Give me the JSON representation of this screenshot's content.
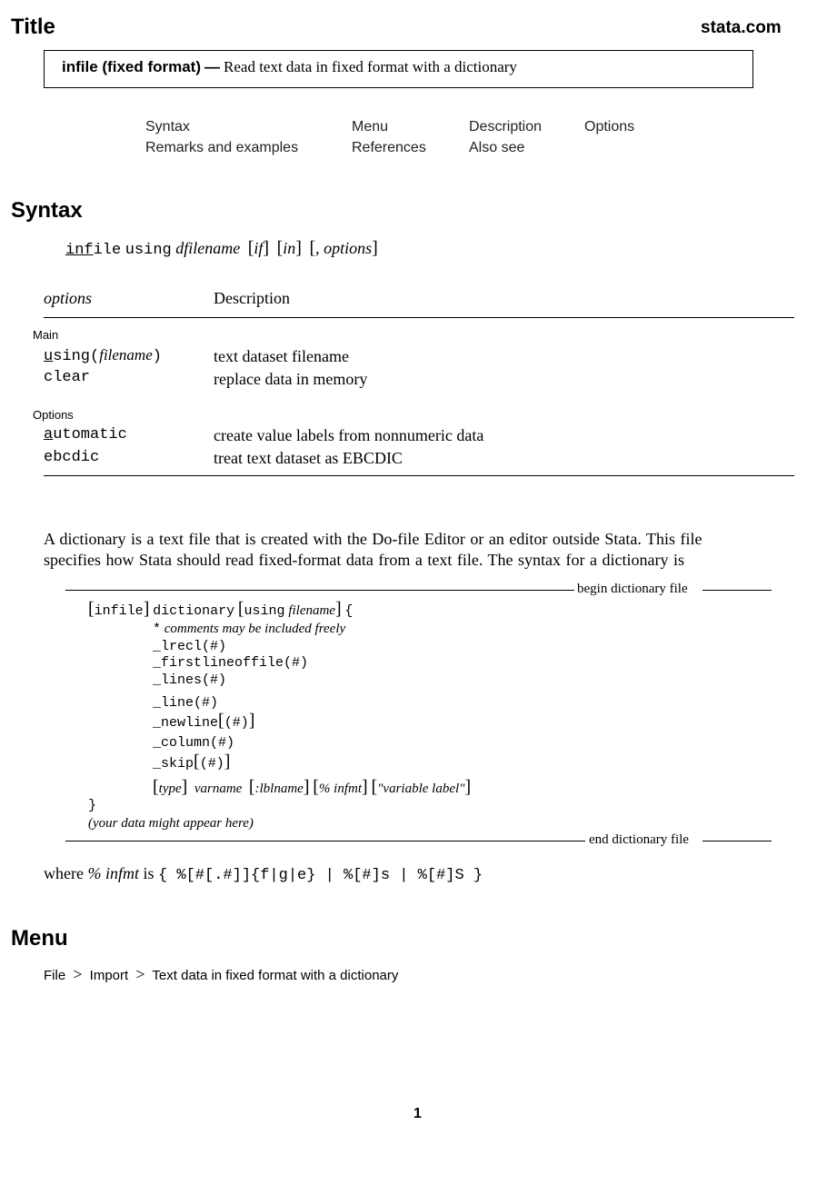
{
  "header": {
    "section_title": "Title",
    "site": "stata.com"
  },
  "title_box": {
    "command": "infile (fixed format)",
    "dash": "—",
    "description": "Read text data in fixed format with a dictionary"
  },
  "nav_links": [
    {
      "label": "Syntax"
    },
    {
      "label": "Menu"
    },
    {
      "label": "Description"
    },
    {
      "label": "Options"
    },
    {
      "label": "Remarks and examples"
    },
    {
      "label": "References"
    },
    {
      "label": "Also see"
    }
  ],
  "syntax": {
    "heading": "Syntax",
    "cmd_abbrev": "inf",
    "cmd_rest": "ile",
    "using": "using",
    "dfilename": "dfilename",
    "if": "if",
    "in": "in",
    "comma": ",",
    "options": "options"
  },
  "options_table": {
    "col_options": "options",
    "col_description": "Description",
    "groups": [
      {
        "label": "Main",
        "rows": [
          {
            "abbrev": "u",
            "rest": "sing(",
            "arg": "filename",
            "close": ")",
            "description": "text dataset filename"
          },
          {
            "abbrev": "",
            "rest": "clear",
            "arg": "",
            "close": "",
            "description": "replace data in memory"
          }
        ]
      },
      {
        "label": "Options",
        "rows": [
          {
            "abbrev": "a",
            "rest": "utomatic",
            "arg": "",
            "close": "",
            "description": "create value labels from nonnumeric data"
          },
          {
            "abbrev": "",
            "rest": "ebcdic",
            "arg": "",
            "close": "",
            "description": "treat text dataset as EBCDIC"
          }
        ]
      }
    ]
  },
  "paragraph": {
    "line1": "A dictionary is a text file that is created with the Do-file Editor or an editor outside Stata. This file",
    "line2": "specifies how Stata should read fixed-format data from a text file. The syntax for a dictionary is"
  },
  "dictionary": {
    "begin_label": "begin dictionary file",
    "end_label": "end dictionary file",
    "line_infile": "infile",
    "line_dictionary": "dictionary",
    "line_using": "using",
    "line_filename": "filename",
    "line_brace_open": "{",
    "comment_star": "*",
    "comment_text": "comments may be included freely",
    "directives": [
      {
        "name": "_lrecl",
        "arg": "(#)",
        "optional": false
      },
      {
        "name": "_firstlineoffile",
        "arg": "(#)",
        "optional": false
      },
      {
        "name": "_lines",
        "arg": "(#)",
        "optional": false
      },
      {
        "name": "_line",
        "arg": "(#)",
        "optional": false
      },
      {
        "name": "_newline",
        "arg": "(#)",
        "optional": true
      },
      {
        "name": "_column",
        "arg": "(#)",
        "optional": false
      },
      {
        "name": "_skip",
        "arg": "(#)",
        "optional": true
      }
    ],
    "var_type": "type",
    "var_varname": "varname",
    "var_lblname": ":lblname",
    "var_infmt": "% infmt",
    "var_label": "\"variable label\"",
    "brace_close": "}",
    "data_note": "(your data might appear here)"
  },
  "where_line": {
    "where": "where",
    "infmt": "% infmt",
    "is": "is",
    "formula": "{ %[#[.#]]{f|g|e} | %[#]s | %[#]S }"
  },
  "menu": {
    "heading": "Menu",
    "path": [
      "File",
      "Import",
      "Text data in fixed format with a dictionary"
    ],
    "separator": ">"
  },
  "footer": {
    "page_number": "1"
  }
}
